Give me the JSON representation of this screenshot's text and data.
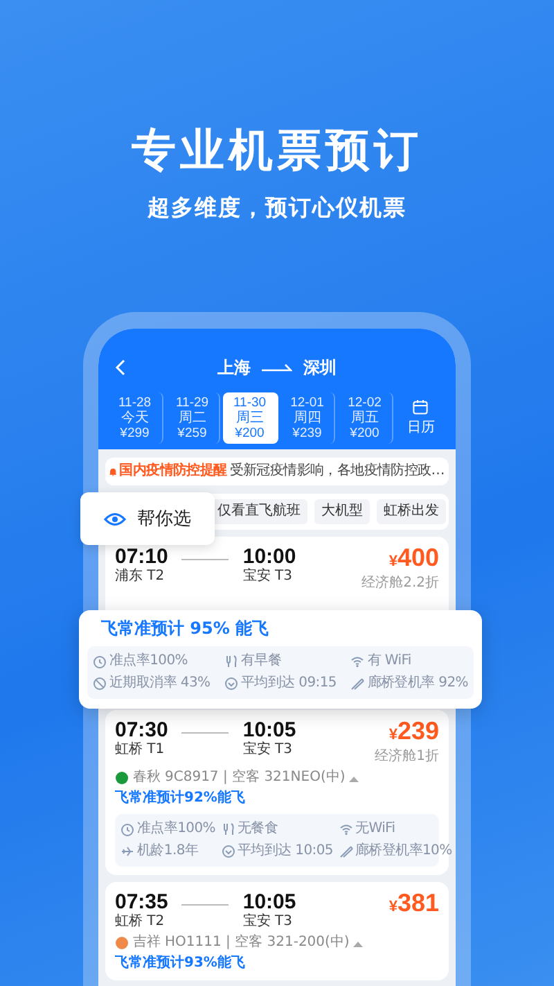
{
  "hero": {
    "title": "专业机票预订",
    "subtitle": "超多维度，预订心仪机票"
  },
  "header": {
    "from": "上海",
    "to": "深圳",
    "calendar_label": "日历"
  },
  "dates": [
    {
      "date": "11-28",
      "day": "今天",
      "price": "¥299",
      "selected": false
    },
    {
      "date": "11-29",
      "day": "周二",
      "price": "¥259",
      "selected": false
    },
    {
      "date": "11-30",
      "day": "周三",
      "price": "¥200",
      "selected": true
    },
    {
      "date": "12-01",
      "day": "周四",
      "price": "¥239",
      "selected": false
    },
    {
      "date": "12-02",
      "day": "周五",
      "price": "¥200",
      "selected": false
    }
  ],
  "notice": {
    "title": "国内疫情防控提醒",
    "text": "受新冠疫情影响，各地疫情防控政…"
  },
  "filters": [
    "仅看直飞航班",
    "大机型",
    "虹桥出发"
  ],
  "pick_button": "帮你选",
  "highlight": {
    "forecast": "飞常准预计 95% 能飞",
    "amenities": [
      {
        "kind": "clock",
        "text": "准点率100%"
      },
      {
        "kind": "meal",
        "text": "有早餐"
      },
      {
        "kind": "wifi",
        "text": "有 WiFi"
      },
      {
        "kind": "cancel",
        "text": "近期取消率 43%"
      },
      {
        "kind": "arrival",
        "text": "平均到达 09:15"
      },
      {
        "kind": "bridge",
        "text": "廊桥登机率 92%"
      }
    ]
  },
  "flights": [
    {
      "dep_time": "07:10",
      "arr_time": "10:00",
      "dep_airport": "浦东 T2",
      "arr_airport": "宝安 T3",
      "currency": "¥",
      "price": "400",
      "cabin": "经济舱2.2折"
    },
    {
      "dep_time": "07:30",
      "arr_time": "10:05",
      "dep_airport": "虹桥 T1",
      "arr_airport": "宝安 T3",
      "currency": "¥",
      "price": "239",
      "cabin": "经济舱1折",
      "airline": {
        "name": "春秋",
        "details": "9C8917 | 空客 321NEO(中)",
        "color": "#1a9a3a"
      },
      "forecast": "飞常准预计92%能飞",
      "amenities": [
        {
          "kind": "clock",
          "text": "准点率100%"
        },
        {
          "kind": "meal",
          "text": "无餐食"
        },
        {
          "kind": "wifi",
          "text": "无WiFi"
        },
        {
          "kind": "plane",
          "text": "机龄1.8年"
        },
        {
          "kind": "arrival",
          "text": "平均到达 10:05"
        },
        {
          "kind": "bridge",
          "text": "廊桥登机率10%"
        }
      ]
    },
    {
      "dep_time": "07:35",
      "arr_time": "10:05",
      "dep_airport": "虹桥 T2",
      "arr_airport": "宝安 T3",
      "currency": "¥",
      "price": "381",
      "airline": {
        "name": "吉祥",
        "details": "HO1111 | 空客 321-200(中)",
        "color": "#f08a4b"
      },
      "forecast": "飞常准预计93%能飞"
    }
  ]
}
